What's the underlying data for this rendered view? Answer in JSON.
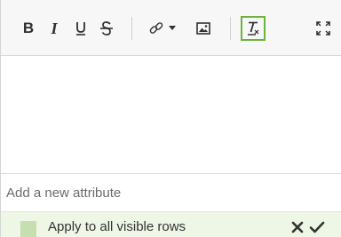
{
  "toolbar": {
    "bold_label": "B",
    "italic_label": "I",
    "underline_icon": "underline-icon",
    "strikethrough_icon": "strikethrough-icon",
    "link_icon": "link-icon",
    "dropdown_icon": "caret-down-icon",
    "image_icon": "image-icon",
    "clear_formatting_icon": "clear-formatting-icon",
    "fullscreen_icon": "expand-icon",
    "active_highlight_color": "#6cb33e"
  },
  "editor": {
    "content": ""
  },
  "attribute_input": {
    "placeholder": "Add a new attribute",
    "value": ""
  },
  "apply_row": {
    "label": "Apply to all visible rows",
    "checkbox_checked": false,
    "checkbox_color": "#c7deb1",
    "row_background": "#eef6e6",
    "cancel_icon": "close-icon",
    "confirm_icon": "check-icon"
  }
}
